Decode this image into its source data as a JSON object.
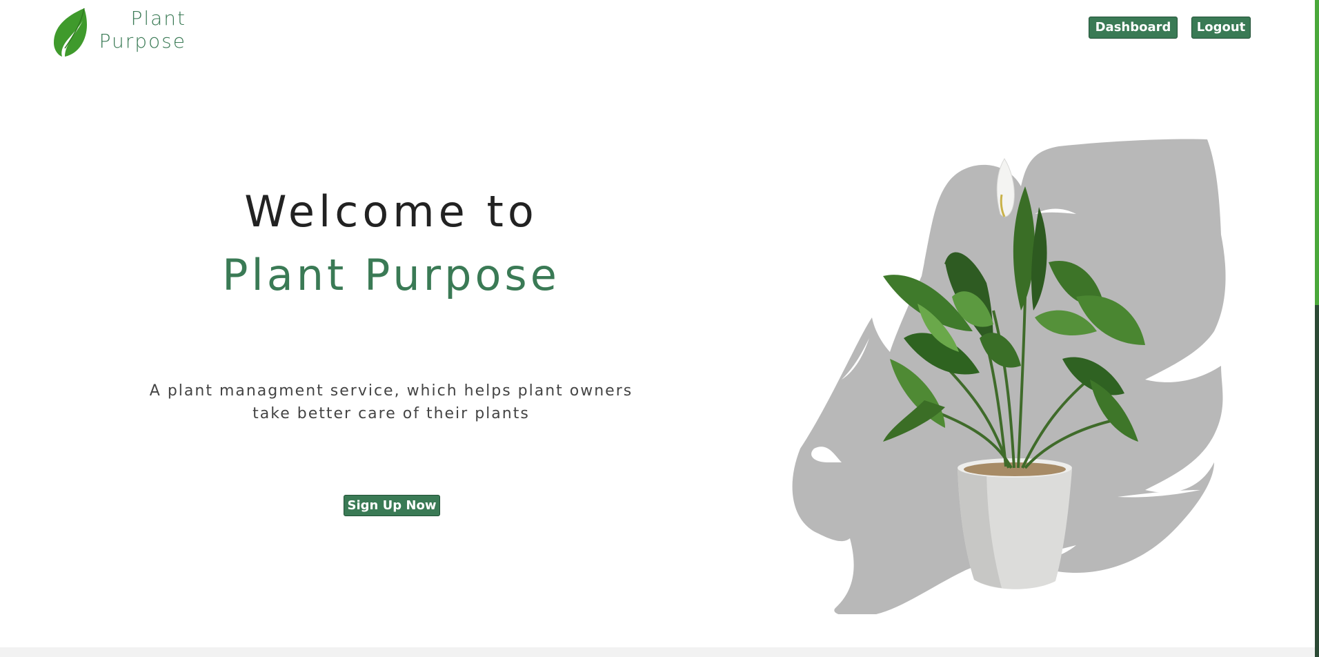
{
  "header": {
    "logo": {
      "line1": "Plant",
      "line2": "Purpose",
      "icon": "leaf-icon"
    },
    "nav": {
      "dashboard_label": "Dashboard",
      "logout_label": "Logout"
    }
  },
  "hero": {
    "title": "Welcome to",
    "brand": "Plant Purpose",
    "description": "A plant managment service, which helps plant owners take better care of their plants",
    "cta_label": "Sign Up Now"
  },
  "illustration": {
    "subject": "potted plant",
    "background_shape": "monstera leaf"
  },
  "colors": {
    "brand_green": "#3a7a55",
    "button_border": "#1f4f34",
    "title_text": "#222222",
    "body_text": "#444444",
    "leaf_shadow": "#b8b8b8",
    "scrollbar_track": "#2c4a35",
    "scrollbar_thumb": "#4aa83a"
  }
}
